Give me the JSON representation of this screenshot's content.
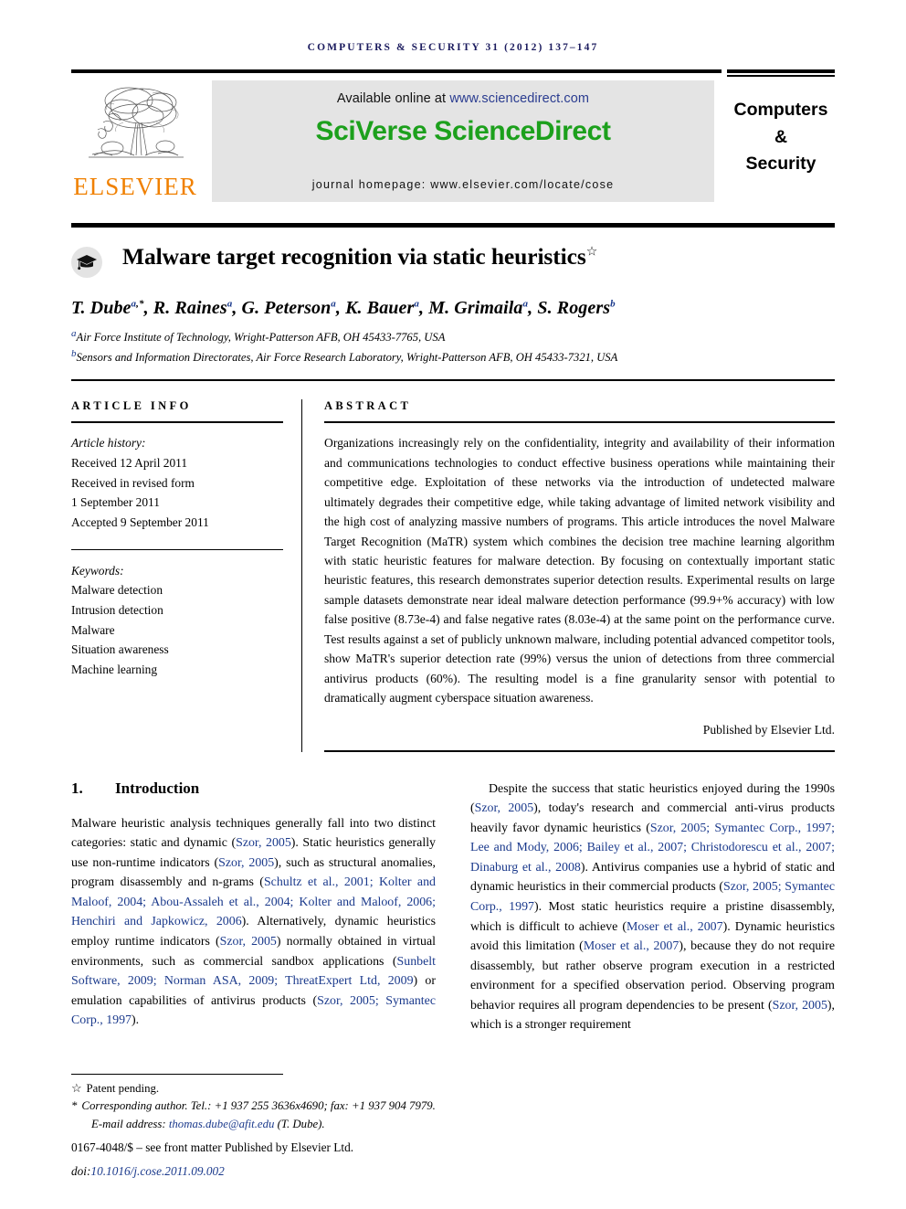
{
  "running_head": "COMPUTERS & SECURITY 31 (2012) 137–147",
  "masthead": {
    "available_prefix": "Available online at ",
    "available_url": "www.sciencedirect.com",
    "sciverse_title": "SciVerse ScienceDirect",
    "homepage": "journal homepage: www.elsevier.com/locate/cose",
    "publisher_wordmark": "ELSEVIER",
    "journal_title_line1": "Computers",
    "journal_title_line2": "&",
    "journal_title_line3": "Security",
    "sciencedirect_green": "#1ca01c",
    "elsevier_orange": "#f08000",
    "link_blue": "#2a3c90"
  },
  "title": {
    "text": "Malware target recognition via static heuristics",
    "footnote_mark": "☆"
  },
  "authors": {
    "list": [
      {
        "name": "T. Dube",
        "sup": "a",
        "star": true
      },
      {
        "name": "R. Raines",
        "sup": "a"
      },
      {
        "name": "G. Peterson",
        "sup": "a"
      },
      {
        "name": "K. Bauer",
        "sup": "a"
      },
      {
        "name": "M. Grimaila",
        "sup": "a"
      },
      {
        "name": "S. Rogers",
        "sup": "b"
      }
    ],
    "affiliations": [
      {
        "mark": "a",
        "text": "Air Force Institute of Technology, Wright-Patterson AFB, OH 45433-7765, USA"
      },
      {
        "mark": "b",
        "text": "Sensors and Information Directorates, Air Force Research Laboratory, Wright-Patterson AFB, OH 45433-7321, USA"
      }
    ]
  },
  "article_info": {
    "label": "ARTICLE INFO",
    "history_label": "Article history:",
    "history": [
      "Received 12 April 2011",
      "Received in revised form",
      "1 September 2011",
      "Accepted 9 September 2011"
    ],
    "keywords_label": "Keywords:",
    "keywords": [
      "Malware detection",
      "Intrusion detection",
      "Malware",
      "Situation awareness",
      "Machine learning"
    ]
  },
  "abstract": {
    "label": "ABSTRACT",
    "text": "Organizations increasingly rely on the confidentiality, integrity and availability of their information and communications technologies to conduct effective business operations while maintaining their competitive edge. Exploitation of these networks via the introduction of undetected malware ultimately degrades their competitive edge, while taking advantage of limited network visibility and the high cost of analyzing massive numbers of programs. This article introduces the novel Malware Target Recognition (MaTR) system which combines the decision tree machine learning algorithm with static heuristic features for malware detection. By focusing on contextually important static heuristic features, this research demonstrates superior detection results. Experimental results on large sample datasets demonstrate near ideal malware detection performance (99.9+% accuracy) with low false positive (8.73e-4) and false negative rates (8.03e-4) at the same point on the performance curve. Test results against a set of publicly unknown malware, including potential advanced competitor tools, show MaTR's superior detection rate (99%) versus the union of detections from three commercial antivirus products (60%). The resulting model is a fine granularity sensor with potential to dramatically augment cyberspace situation awareness.",
    "published_by": "Published by Elsevier Ltd."
  },
  "section": {
    "number": "1.",
    "heading": "Introduction"
  },
  "body": {
    "left_paragraph_parts": [
      {
        "t": "Malware heuristic analysis techniques generally fall into two distinct categories: static and dynamic (",
        "cite": false
      },
      {
        "t": "Szor, 2005",
        "cite": true
      },
      {
        "t": "). Static heuristics generally use non-runtime indicators (",
        "cite": false
      },
      {
        "t": "Szor, 2005",
        "cite": true
      },
      {
        "t": "), such as structural anomalies, program disassembly and n-grams (",
        "cite": false
      },
      {
        "t": "Schultz et al., 2001; Kolter and Maloof, 2004; Abou-Assaleh et al., 2004; Kolter and Maloof, 2006; Henchiri and Japkowicz, 2006",
        "cite": true
      },
      {
        "t": "). Alternatively, dynamic heuristics employ runtime indicators (",
        "cite": false
      },
      {
        "t": "Szor, 2005",
        "cite": true
      },
      {
        "t": ") normally obtained in virtual environments, such as commercial sandbox applications (",
        "cite": false
      },
      {
        "t": "Sunbelt Software, 2009; Norman ASA, 2009; ThreatExpert Ltd, 2009",
        "cite": true
      },
      {
        "t": ") or emulation capabilities of antivirus products (",
        "cite": false
      },
      {
        "t": "Szor, 2005; Symantec Corp., 1997",
        "cite": true
      },
      {
        "t": ").",
        "cite": false
      }
    ],
    "right_paragraph_parts": [
      {
        "t": "Despite the success that static heuristics enjoyed during the 1990s (",
        "cite": false
      },
      {
        "t": "Szor, 2005",
        "cite": true
      },
      {
        "t": "), today's research and commercial anti-virus products heavily favor dynamic heuristics (",
        "cite": false
      },
      {
        "t": "Szor, 2005; Symantec Corp., 1997; Lee and Mody, 2006; Bailey et al., 2007; Christodorescu et al., 2007; Dinaburg et al., 2008",
        "cite": true
      },
      {
        "t": "). Antivirus companies use a hybrid of static and dynamic heuristics in their commercial products (",
        "cite": false
      },
      {
        "t": "Szor, 2005; Symantec Corp., 1997",
        "cite": true
      },
      {
        "t": "). Most static heuristics require a pristine disassembly, which is difficult to achieve (",
        "cite": false
      },
      {
        "t": "Moser et al., 2007",
        "cite": true
      },
      {
        "t": "). Dynamic heuristics avoid this limitation (",
        "cite": false
      },
      {
        "t": "Moser et al., 2007",
        "cite": true
      },
      {
        "t": "), because they do not require disassembly, but rather observe program execution in a restricted environment for a specified observation period. Observing program behavior requires all program dependencies to be present (",
        "cite": false
      },
      {
        "t": "Szor, 2005",
        "cite": true
      },
      {
        "t": "), which is a stronger requirement",
        "cite": false
      }
    ]
  },
  "footnotes": {
    "patent_mark": "☆",
    "patent_text": "Patent pending.",
    "corresponding_mark": "*",
    "corresponding_text": "Corresponding author. Tel.: +1 937 255 3636x4690; fax: +1 937 904 7979.",
    "email_label": "E-mail address: ",
    "email": "thomas.dube@afit.edu",
    "email_suffix": " (T. Dube).",
    "issn_line": "0167-4048/$ – see front matter Published by Elsevier Ltd.",
    "doi_label": "doi:",
    "doi": "10.1016/j.cose.2011.09.002"
  }
}
